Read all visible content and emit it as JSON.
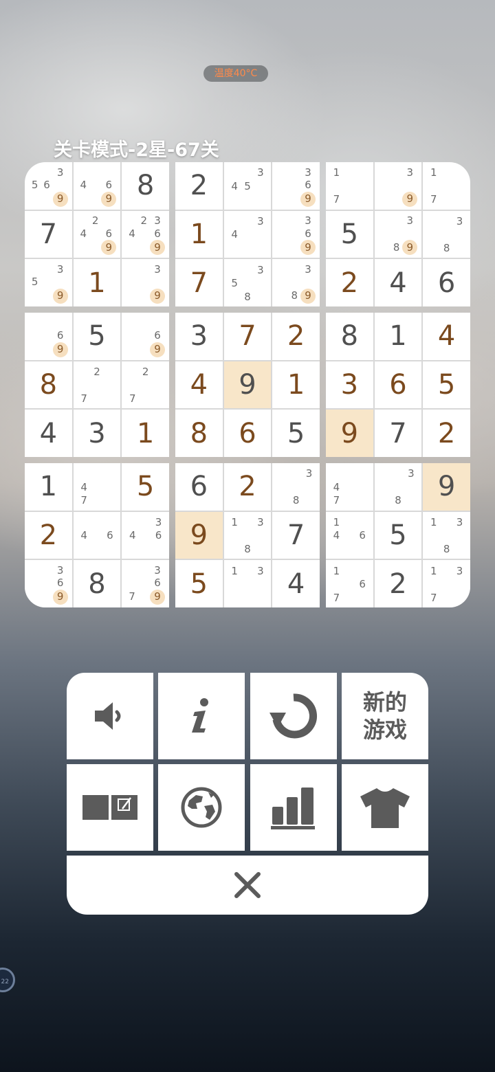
{
  "status": {
    "temperature": "温度40°C"
  },
  "title": "关卡模式-2星-67关",
  "board": {
    "cells": [
      [
        {
          "n": [
            "",
            "",
            "3",
            "5",
            "6",
            "",
            "",
            "",
            "9"
          ],
          "m": [
            9
          ]
        },
        {
          "n": [
            "",
            "",
            "",
            "4",
            "",
            "6",
            "",
            "",
            "9"
          ],
          "m": [
            9
          ]
        },
        {
          "v": "8",
          "t": "given"
        },
        {
          "v": "2",
          "t": "given"
        },
        {
          "n": [
            "",
            "",
            "3",
            "4",
            "5",
            "",
            "",
            "",
            ""
          ]
        },
        {
          "n": [
            "",
            "",
            "3",
            "",
            "",
            "6",
            "",
            "",
            "9"
          ],
          "m": [
            9
          ]
        },
        {
          "n": [
            "1",
            "",
            "",
            "",
            "",
            "",
            "7",
            "",
            ""
          ]
        },
        {
          "n": [
            "",
            "",
            "3",
            "",
            "",
            "",
            "",
            "",
            "9"
          ],
          "m": [
            9
          ]
        },
        {
          "n": [
            "1",
            "",
            "",
            "",
            "",
            "",
            "7",
            "",
            ""
          ]
        }
      ],
      [
        {
          "v": "7",
          "t": "given"
        },
        {
          "n": [
            "",
            "2",
            "",
            "4",
            "",
            "6",
            "",
            "",
            "9"
          ],
          "m": [
            9
          ]
        },
        {
          "n": [
            "",
            "2",
            "3",
            "4",
            "",
            "6",
            "",
            "",
            "9"
          ],
          "m": [
            9
          ]
        },
        {
          "v": "1",
          "t": "entered"
        },
        {
          "n": [
            "",
            "",
            "3",
            "4",
            "",
            "",
            "",
            "",
            ""
          ]
        },
        {
          "n": [
            "",
            "",
            "3",
            "",
            "",
            "6",
            "",
            "",
            "9"
          ],
          "m": [
            9
          ]
        },
        {
          "v": "5",
          "t": "given"
        },
        {
          "n": [
            "",
            "",
            "3",
            "",
            "",
            "",
            "",
            "8",
            "9"
          ],
          "m": [
            9
          ]
        },
        {
          "n": [
            "",
            "",
            "3",
            "",
            "",
            "",
            "",
            "8",
            ""
          ]
        }
      ],
      [
        {
          "n": [
            "",
            "",
            "3",
            "5",
            "",
            "",
            "",
            "",
            "9"
          ],
          "m": [
            9
          ]
        },
        {
          "v": "1",
          "t": "entered"
        },
        {
          "n": [
            "",
            "",
            "3",
            "",
            "",
            "",
            "",
            "",
            "9"
          ],
          "m": [
            9
          ]
        },
        {
          "v": "7",
          "t": "entered"
        },
        {
          "n": [
            "",
            "",
            "3",
            "5",
            "",
            "",
            "",
            "8",
            ""
          ]
        },
        {
          "n": [
            "",
            "",
            "3",
            "",
            "",
            "",
            "",
            "8",
            "9"
          ],
          "m": [
            9
          ]
        },
        {
          "v": "2",
          "t": "entered"
        },
        {
          "v": "4",
          "t": "given"
        },
        {
          "v": "6",
          "t": "given"
        }
      ],
      [
        {
          "n": [
            "",
            "",
            "",
            "",
            "",
            "6",
            "",
            "",
            "9"
          ],
          "m": [
            9
          ]
        },
        {
          "v": "5",
          "t": "given"
        },
        {
          "n": [
            "",
            "",
            "",
            "",
            "",
            "6",
            "",
            "",
            "9"
          ],
          "m": [
            9
          ]
        },
        {
          "v": "3",
          "t": "given"
        },
        {
          "v": "7",
          "t": "entered"
        },
        {
          "v": "2",
          "t": "entered"
        },
        {
          "v": "8",
          "t": "given"
        },
        {
          "v": "1",
          "t": "given"
        },
        {
          "v": "4",
          "t": "entered"
        }
      ],
      [
        {
          "v": "8",
          "t": "entered"
        },
        {
          "n": [
            "",
            "2",
            "",
            "",
            "",
            "",
            "7",
            "",
            ""
          ]
        },
        {
          "n": [
            "",
            "2",
            "",
            "",
            "",
            "",
            "7",
            "",
            ""
          ]
        },
        {
          "v": "4",
          "t": "entered"
        },
        {
          "v": "9",
          "t": "given",
          "h": true
        },
        {
          "v": "1",
          "t": "entered"
        },
        {
          "v": "3",
          "t": "entered"
        },
        {
          "v": "6",
          "t": "entered"
        },
        {
          "v": "5",
          "t": "entered"
        }
      ],
      [
        {
          "v": "4",
          "t": "given"
        },
        {
          "v": "3",
          "t": "given"
        },
        {
          "v": "1",
          "t": "entered"
        },
        {
          "v": "8",
          "t": "entered"
        },
        {
          "v": "6",
          "t": "entered"
        },
        {
          "v": "5",
          "t": "given"
        },
        {
          "v": "9",
          "t": "entered",
          "h": true
        },
        {
          "v": "7",
          "t": "given"
        },
        {
          "v": "2",
          "t": "entered"
        }
      ],
      [
        {
          "v": "1",
          "t": "given"
        },
        {
          "n": [
            "",
            "",
            "",
            "4",
            "",
            "",
            "7",
            "",
            ""
          ]
        },
        {
          "v": "5",
          "t": "entered"
        },
        {
          "v": "6",
          "t": "given"
        },
        {
          "v": "2",
          "t": "entered"
        },
        {
          "n": [
            "",
            "",
            "3",
            "",
            "",
            "",
            "",
            "8",
            ""
          ]
        },
        {
          "n": [
            "",
            "",
            "",
            "4",
            "",
            "",
            "7",
            "",
            ""
          ]
        },
        {
          "n": [
            "",
            "",
            "3",
            "",
            "",
            "",
            "",
            "8",
            ""
          ]
        },
        {
          "v": "9",
          "t": "given",
          "h": true
        }
      ],
      [
        {
          "v": "2",
          "t": "entered"
        },
        {
          "n": [
            "",
            "",
            "",
            "4",
            "",
            "6",
            "",
            "",
            ""
          ]
        },
        {
          "n": [
            "",
            "",
            "3",
            "4",
            "",
            "6",
            "",
            "",
            ""
          ]
        },
        {
          "v": "9",
          "t": "entered",
          "h": true
        },
        {
          "n": [
            "1",
            "",
            "3",
            "",
            "",
            "",
            "",
            "8",
            ""
          ]
        },
        {
          "v": "7",
          "t": "given"
        },
        {
          "n": [
            "1",
            "",
            "",
            "4",
            "",
            "6",
            "",
            "",
            ""
          ]
        },
        {
          "v": "5",
          "t": "given"
        },
        {
          "n": [
            "1",
            "",
            "3",
            "",
            "",
            "",
            "",
            "8",
            ""
          ]
        }
      ],
      [
        {
          "n": [
            "",
            "",
            "3",
            "",
            "",
            "6",
            "",
            "",
            "9"
          ],
          "m": [
            9
          ]
        },
        {
          "v": "8",
          "t": "given"
        },
        {
          "n": [
            "",
            "",
            "3",
            "",
            "",
            "6",
            "7",
            "",
            "9"
          ],
          "m": [
            9
          ]
        },
        {
          "v": "5",
          "t": "entered"
        },
        {
          "n": [
            "1",
            "",
            "3",
            "",
            "",
            "",
            "",
            "",
            ""
          ]
        },
        {
          "v": "4",
          "t": "given"
        },
        {
          "n": [
            "1",
            "",
            "",
            "",
            "",
            "6",
            "7",
            "",
            ""
          ]
        },
        {
          "v": "2",
          "t": "given"
        },
        {
          "n": [
            "1",
            "",
            "3",
            "",
            "",
            "",
            "7",
            "",
            ""
          ]
        }
      ]
    ]
  },
  "controls": {
    "sound": "sound-icon",
    "info": "info-icon",
    "restart": "restart-icon",
    "new_game": "新的\n游戏",
    "notes": "notes-icon",
    "globe": "globe-icon",
    "stats": "stats-icon",
    "theme": "shirt-icon",
    "close": "close-icon"
  },
  "floating": {
    "label": "22"
  },
  "colors": {
    "accent": "#f8e6c9",
    "entered": "#7b4a1e",
    "given": "#505050",
    "note_mark": "#f6dfbf"
  }
}
